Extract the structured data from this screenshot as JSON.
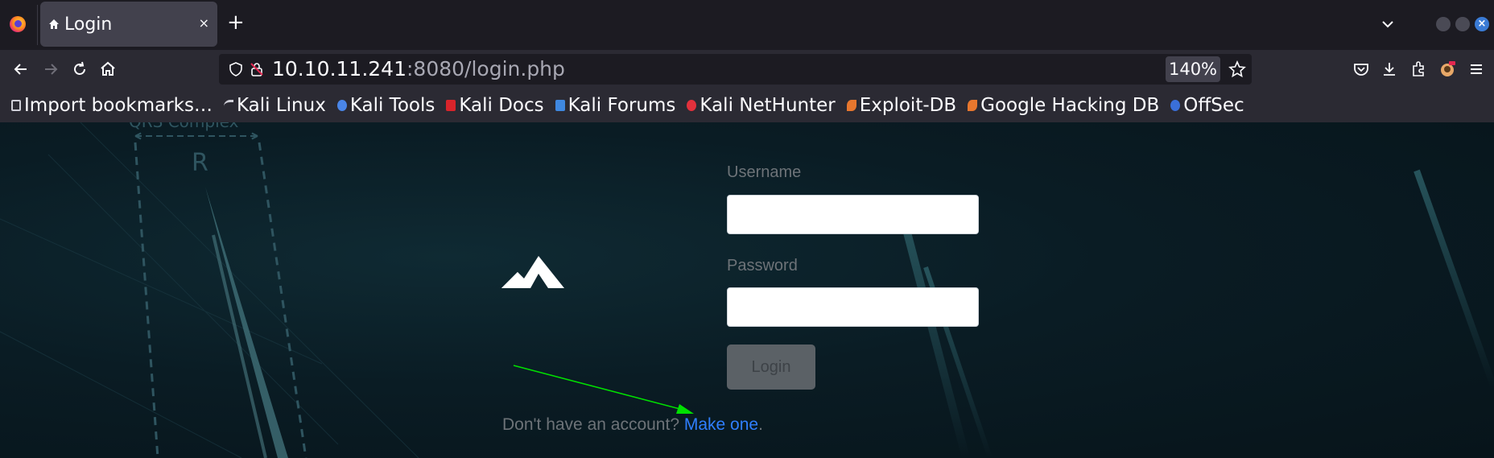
{
  "browser": {
    "tab": {
      "title": "Login",
      "close": "×"
    },
    "new_tab": "+",
    "url": {
      "host": "10.10.11.241",
      "rest": ":8080/login.php"
    },
    "zoom": "140%"
  },
  "bookmarks": [
    {
      "label": "Import bookmarks…",
      "icon": "import-icon",
      "color": "#cfcfd8"
    },
    {
      "label": "Kali Linux",
      "icon": "kali-dragon-icon",
      "color": "#cfcfd8"
    },
    {
      "label": "Kali Tools",
      "icon": "kali-tools-icon",
      "color": "#4a86e8"
    },
    {
      "label": "Kali Docs",
      "icon": "kali-docs-icon",
      "color": "#d9242b"
    },
    {
      "label": "Kali Forums",
      "icon": "kali-forums-icon",
      "color": "#3f88e0"
    },
    {
      "label": "Kali NetHunter",
      "icon": "nethunter-icon",
      "color": "#e2313c"
    },
    {
      "label": "Exploit-DB",
      "icon": "exploit-db-icon",
      "color": "#e8772e"
    },
    {
      "label": "Google Hacking DB",
      "icon": "ghdb-icon",
      "color": "#e8772e"
    },
    {
      "label": "OffSec",
      "icon": "offsec-icon",
      "color": "#3a6fd8"
    }
  ],
  "login": {
    "username_label": "Username",
    "password_label": "Password",
    "button_label": "Login",
    "signup_prompt": "Don't have an account? ",
    "signup_link": "Make one",
    "signup_suffix": "."
  },
  "background": {
    "watermark": "QRS Complex",
    "letter": "R"
  },
  "colors": {
    "accent_link": "#2f7fff",
    "annotation_arrow": "#00e000"
  }
}
